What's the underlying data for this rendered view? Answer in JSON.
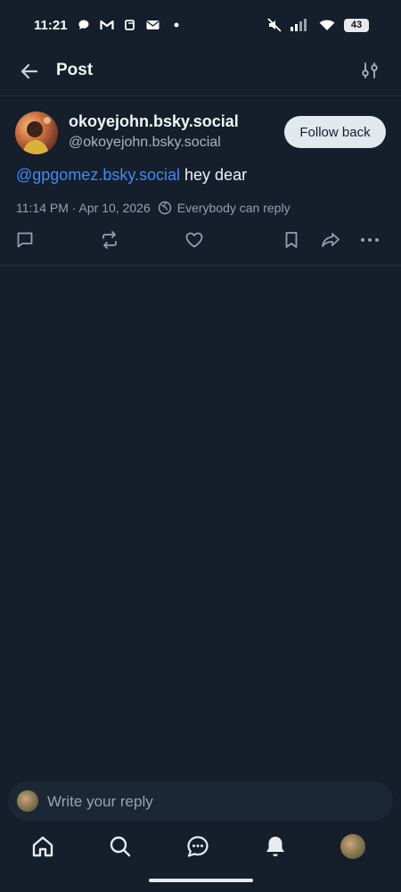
{
  "status_bar": {
    "time": "11:21",
    "battery": "43",
    "left_icons": [
      "chat-bubble-icon",
      "gmail-icon",
      "copy-icon",
      "mail-icon",
      "dot-icon"
    ],
    "right_icons": [
      "mute-icon",
      "signal-icon",
      "wifi-icon",
      "battery-icon"
    ]
  },
  "header": {
    "title": "Post",
    "back_icon": "arrow-left-icon",
    "filter_icon": "sliders-icon"
  },
  "post": {
    "author_name": "okoyejohn.bsky.social",
    "author_handle": "@okoyejohn.bsky.social",
    "follow_label": "Follow back",
    "mention": "@gpgomez.bsky.social",
    "text": " hey dear",
    "timestamp": "11:14 PM · Apr 10, 2026",
    "reply_setting": "Everybody can reply",
    "actions": [
      "reply-icon",
      "repost-icon",
      "like-icon",
      "bookmark-icon",
      "share-icon",
      "more-icon"
    ]
  },
  "composer": {
    "placeholder": "Write your reply"
  },
  "tab_bar": {
    "items": [
      "home-icon",
      "search-icon",
      "messages-icon",
      "notifications-icon",
      "profile-avatar"
    ]
  },
  "colors": {
    "background": "#151e2b",
    "accent": "#3f8bf4",
    "muted_text": "#93a0b3"
  }
}
